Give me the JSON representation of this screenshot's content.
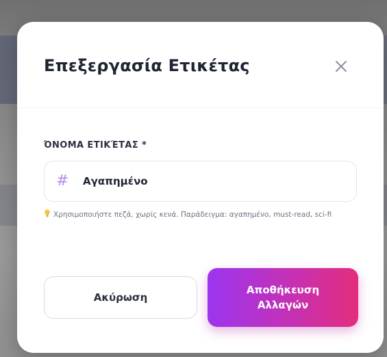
{
  "modal": {
    "title": "Επεξεργασία Ετικέτας",
    "close_icon": "close-icon"
  },
  "form": {
    "label": "ΌΝΟΜΑ ΕΤΙΚΈΤΑΣ *",
    "input_value": "Αγαπημένο",
    "input_icon": "hash-icon",
    "hint_icon": "lightbulb-icon",
    "hint": "Χρησιμοποιήστε πεζά, χωρίς κενά. Παράδειγμα: αγαπημένο, must-read, sci-fi"
  },
  "actions": {
    "cancel_label": "Ακύρωση",
    "save_label_line1": "Αποθήκευση",
    "save_label_line2": "Αλλαγών"
  },
  "colors": {
    "accent_start": "#9b35ef",
    "accent_end": "#e32d7c",
    "hash_icon": "#b48af0",
    "hint_icon": "#f5c542"
  }
}
